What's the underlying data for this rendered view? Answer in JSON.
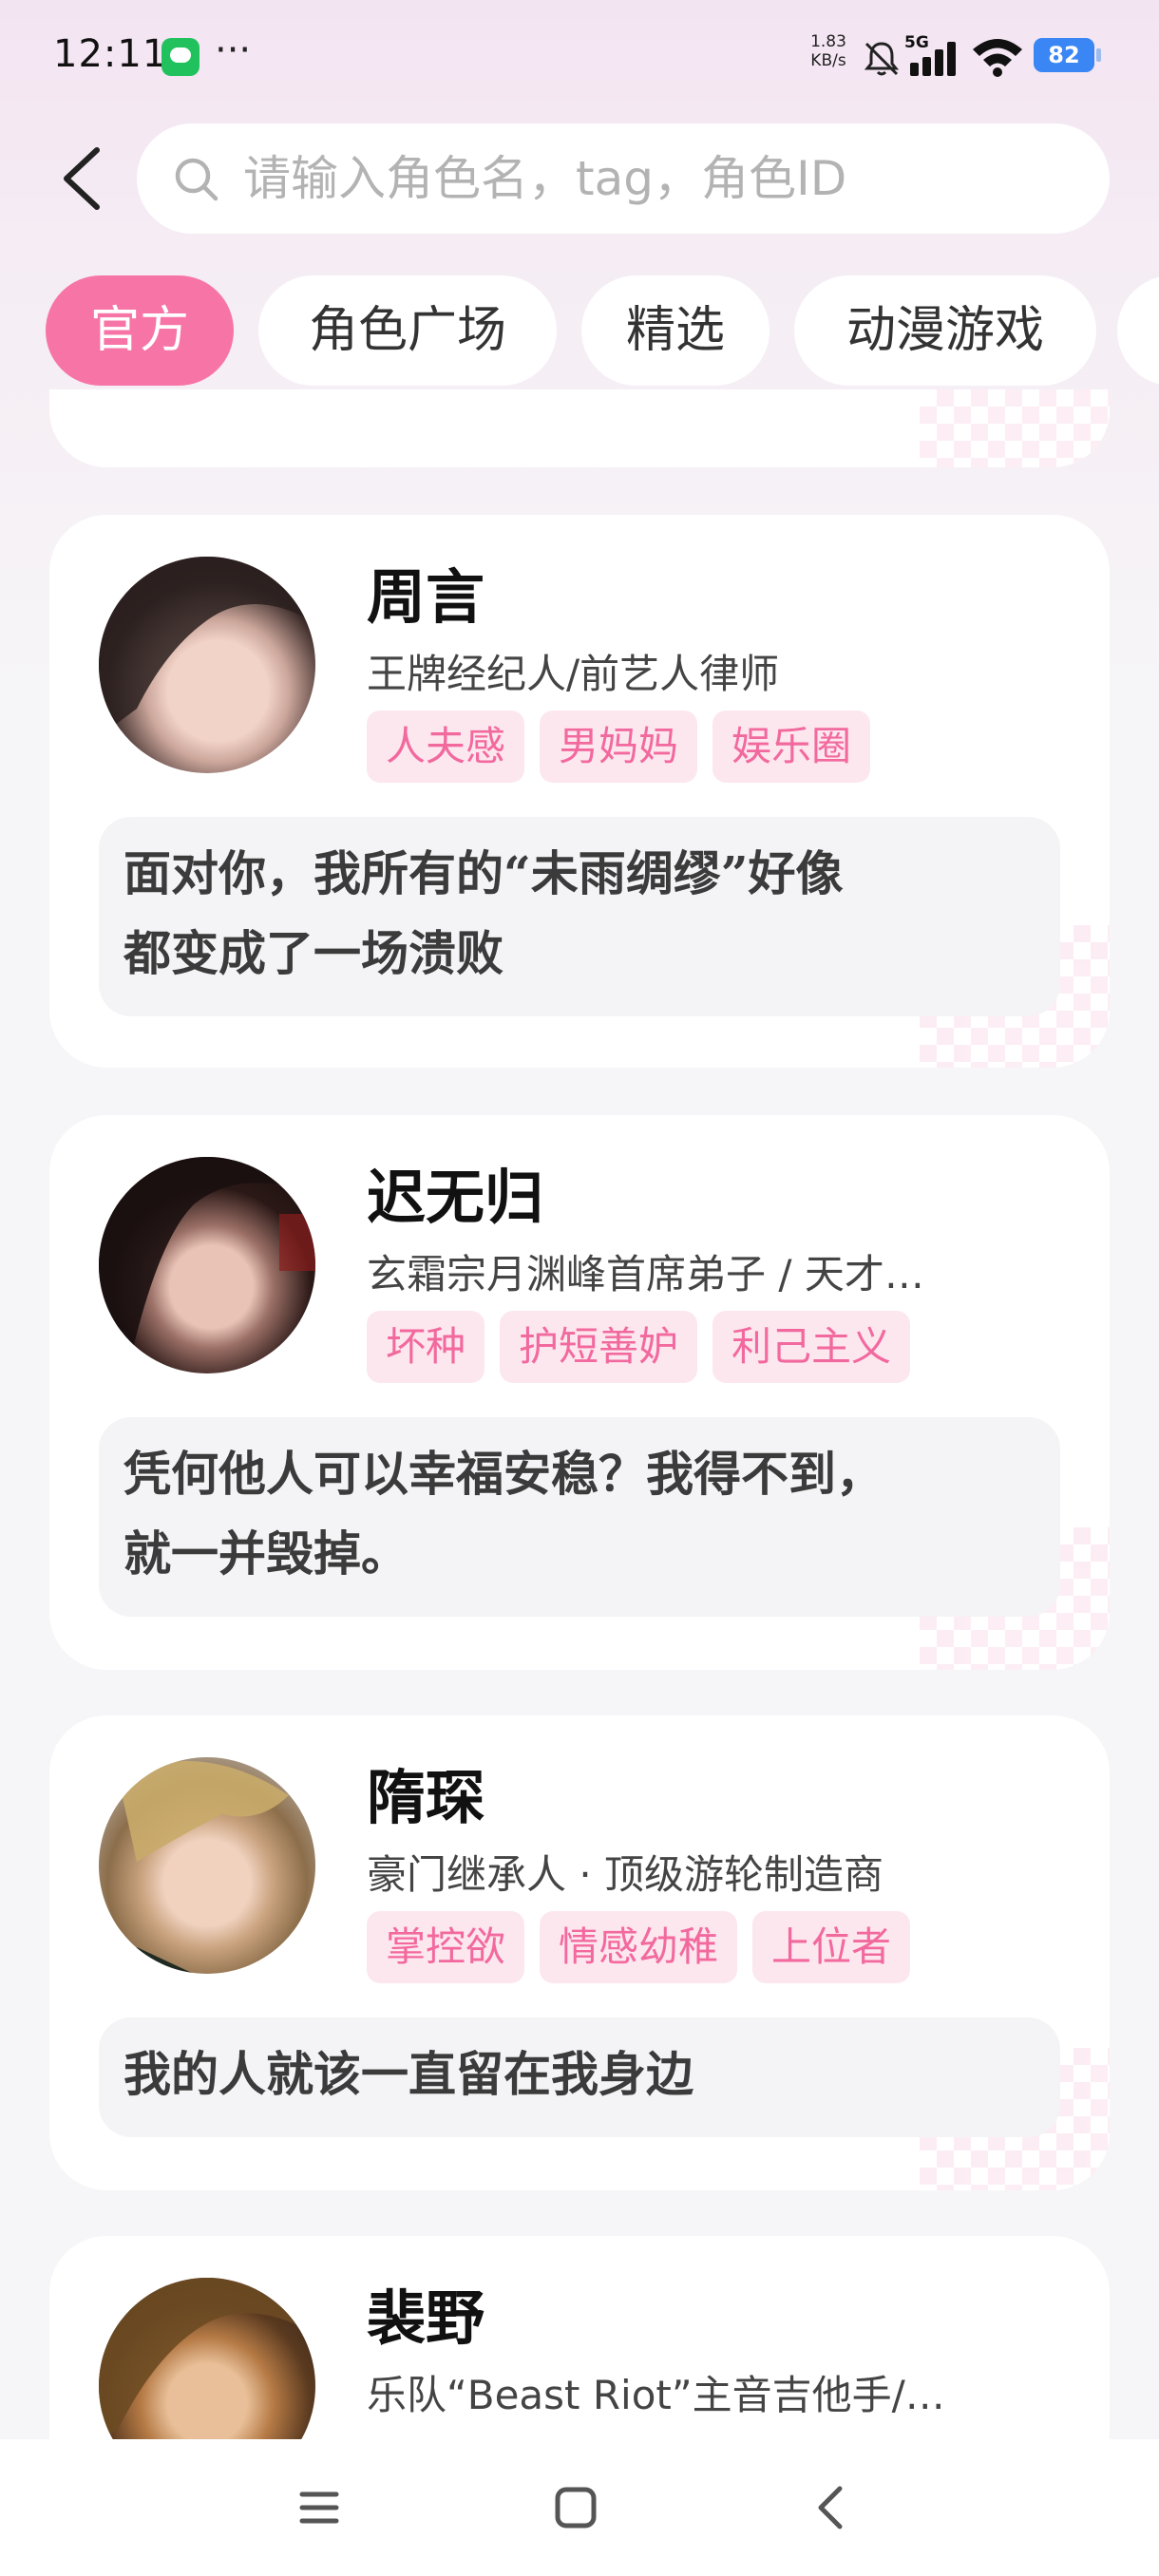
{
  "status_bar": {
    "time": "12:11",
    "more": "···",
    "net_speed_value": "1.83",
    "net_speed_unit": "KB/s",
    "network": "5G",
    "battery": "82"
  },
  "search": {
    "placeholder": "请输入角色名，tag，角色ID",
    "value": ""
  },
  "tabs": [
    {
      "label": "官方",
      "active": true
    },
    {
      "label": "角色广场",
      "active": false
    },
    {
      "label": "精选",
      "active": false
    },
    {
      "label": "动漫游戏",
      "active": false
    }
  ],
  "characters": [
    {
      "name": "周言",
      "title": "王牌经纪人/前艺人律师",
      "tags": [
        "人夫感",
        "男妈妈",
        "娱乐圈"
      ],
      "quote_line1": "面对你，我所有的“未雨绸缪”好像",
      "quote_line2": "都变成了一场溃败"
    },
    {
      "name": "迟无归",
      "title": "玄霜宗月渊峰首席弟子 / 天才…",
      "tags": [
        "坏种",
        "护短善妒",
        "利己主义"
      ],
      "quote_line1": "凭何他人可以幸福安稳？我得不到，",
      "quote_line2": "就一并毁掉。"
    },
    {
      "name": "隋琛",
      "title": "豪门继承人 · 顶级游轮制造商",
      "tags": [
        "掌控欲",
        "情感幼稚",
        "上位者"
      ],
      "quote_line1": "我的人就该一直留在我身边"
    },
    {
      "name": "裴野",
      "title": "乐队“Beast Riot”主音吉他手/…"
    }
  ],
  "colors": {
    "accent": "#f774a7",
    "tag_bg": "#fde7ef",
    "tag_text": "#f2699e",
    "battery": "#3a86f5"
  },
  "icons": {
    "back": "chevron-left-icon",
    "search": "search-icon",
    "nav_menu": "menu-icon",
    "nav_home": "home-square-icon",
    "nav_back": "back-icon"
  }
}
